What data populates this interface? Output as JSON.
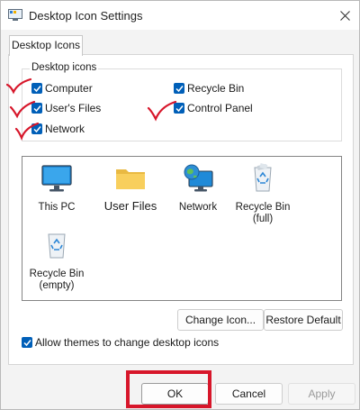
{
  "window": {
    "title": "Desktop Icon Settings"
  },
  "tab": {
    "label": "Desktop Icons"
  },
  "group": {
    "legend": "Desktop icons",
    "checkboxes": [
      {
        "label": "Computer",
        "checked": true
      },
      {
        "label": "User's Files",
        "checked": true
      },
      {
        "label": "Network",
        "checked": true
      },
      {
        "label": "Recycle Bin",
        "checked": true
      },
      {
        "label": "Control Panel",
        "checked": true
      }
    ]
  },
  "icons": [
    {
      "label": "This PC",
      "icon": "monitor-icon"
    },
    {
      "label": "User Files",
      "icon": "folder-icon"
    },
    {
      "label": "Network",
      "icon": "network-globe-icon"
    },
    {
      "label": "Recycle Bin\n(full)",
      "label_line1": "Recycle Bin",
      "label_line2": "(full)",
      "icon": "recycle-bin-full-icon"
    },
    {
      "label": "Recycle Bin\n(empty)",
      "label_line1": "Recycle Bin",
      "label_line2": "(empty)",
      "icon": "recycle-bin-empty-icon"
    }
  ],
  "buttons": {
    "change_icon": "Change Icon...",
    "restore_default": "Restore Default",
    "ok": "OK",
    "cancel": "Cancel",
    "apply": "Apply"
  },
  "allow_themes": {
    "label": "Allow themes to change desktop icons",
    "checked": true
  },
  "colors": {
    "accent": "#005fb8",
    "annotation": "#d7162a"
  }
}
